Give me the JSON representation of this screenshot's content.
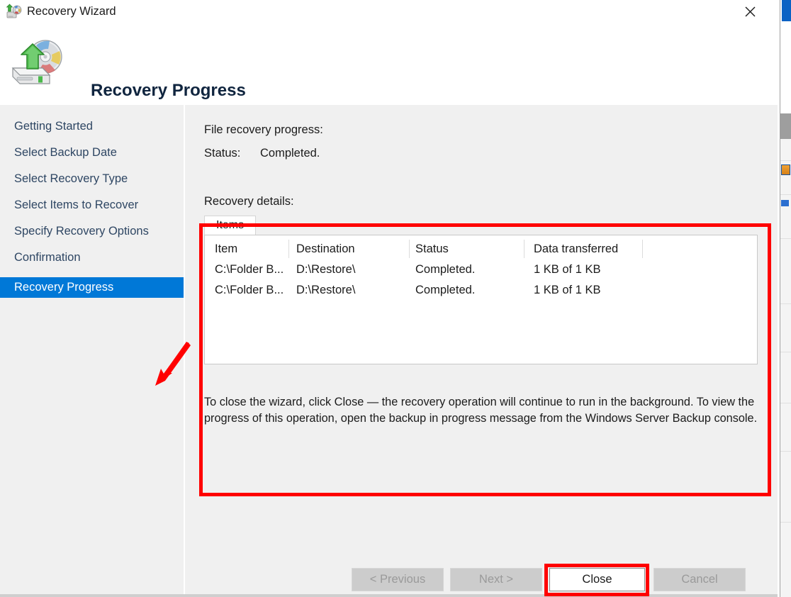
{
  "window": {
    "title": "Recovery Wizard",
    "title_icon": "recovery-wizard-icon",
    "close_icon": "close-icon"
  },
  "header": {
    "title": "Recovery Progress",
    "icon": "disk-restore-icon"
  },
  "sidebar": {
    "items": [
      {
        "label": "Getting Started",
        "selected": false
      },
      {
        "label": "Select Backup Date",
        "selected": false
      },
      {
        "label": "Select Recovery Type",
        "selected": false
      },
      {
        "label": "Select Items to Recover",
        "selected": false
      },
      {
        "label": "Specify Recovery Options",
        "selected": false
      },
      {
        "label": "Confirmation",
        "selected": false
      },
      {
        "label": "Recovery Progress",
        "selected": true
      }
    ]
  },
  "content": {
    "progress_label": "File recovery progress:",
    "status_label": "Status:",
    "status_value": "Completed.",
    "details_label": "Recovery details:",
    "tabs": [
      {
        "label": "Items",
        "selected": true
      }
    ],
    "table": {
      "columns": [
        "Item",
        "Destination",
        "Status",
        "Data transferred",
        ""
      ],
      "rows": [
        [
          "C:\\Folder B...",
          "D:\\Restore\\",
          "Completed.",
          "1 KB of 1 KB",
          ""
        ],
        [
          "C:\\Folder B...",
          "D:\\Restore\\",
          "Completed.",
          "1 KB of 1 KB",
          ""
        ]
      ]
    },
    "note": "To close the wizard, click Close — the recovery operation will continue to run in the background. To view the progress of this operation, open the backup in progress message from the Windows Server Backup console."
  },
  "buttons": {
    "previous": {
      "label": "< Previous",
      "enabled": false
    },
    "next": {
      "label": "Next >",
      "enabled": false
    },
    "close": {
      "label": "Close",
      "enabled": true,
      "highlighted": true
    },
    "cancel": {
      "label": "Cancel",
      "enabled": false
    }
  },
  "annotations": {
    "highlight_color": "#ff0000",
    "content_box": "red-rectangle-around-recovery-details",
    "close_box": "red-rectangle-around-close-button",
    "arrow": "red-arrow-pointing-to-recovery-progress"
  },
  "colors": {
    "accent": "#0078d7",
    "body_background": "#f0f0f0",
    "nav_text": "#2e4663",
    "header_title": "#10253f"
  }
}
